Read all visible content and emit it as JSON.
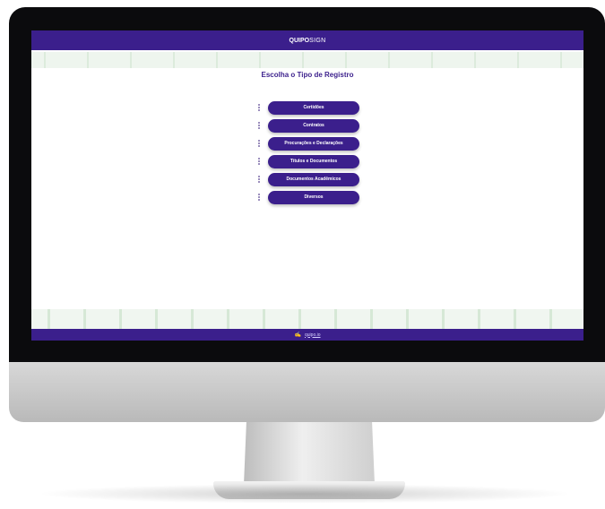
{
  "app": {
    "brand_bold": "QUIPO",
    "brand_light": "SIGN"
  },
  "page": {
    "title": "Escolha o Tipo de Registro"
  },
  "menu": {
    "items": [
      {
        "label": "Certidões"
      },
      {
        "label": "Contratos"
      },
      {
        "label": "Procurações e Declarações"
      },
      {
        "label": "Títulos e Documentos"
      },
      {
        "label": "Documentos Acadêmicos"
      },
      {
        "label": "Diversos"
      }
    ]
  },
  "footer": {
    "icon": "signature-icon",
    "link": "quipo.io"
  },
  "colors": {
    "primary": "#3b1f8c",
    "pattern": "#dcebdc"
  }
}
